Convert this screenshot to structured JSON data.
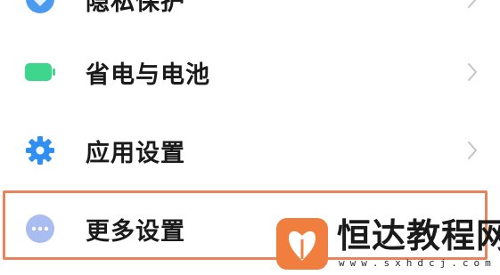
{
  "settings": {
    "items": [
      {
        "label": "隐私保护",
        "icon": "privacy-icon"
      },
      {
        "label": "省电与电池",
        "icon": "battery-icon"
      },
      {
        "label": "应用设置",
        "icon": "gear-icon"
      },
      {
        "label": "更多设置",
        "icon": "more-dots-icon"
      }
    ]
  },
  "watermark": {
    "title": "恒达教程网",
    "url": "www.sxhdcj.com"
  },
  "colors": {
    "battery_green": "#3dd68c",
    "gear_blue": "#2f8ff2",
    "more_lavender": "#a9bdf0",
    "highlight_orange": "#e8835c",
    "logo_orange": "#f07e3f"
  }
}
